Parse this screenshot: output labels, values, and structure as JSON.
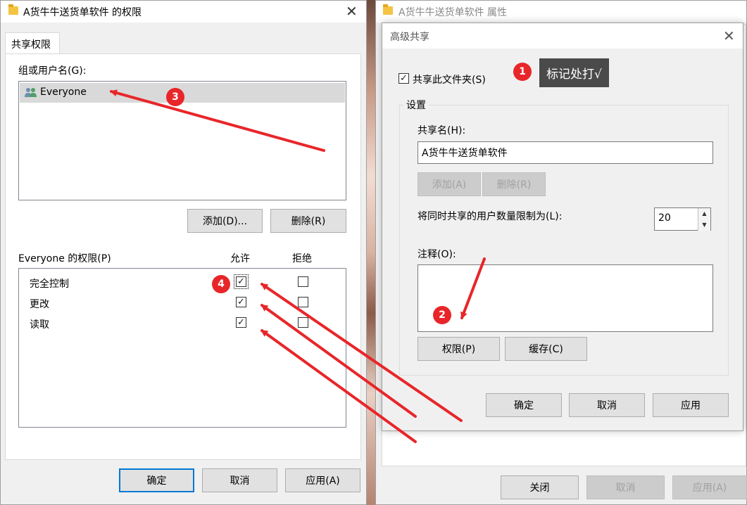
{
  "perm_dialog": {
    "title": "A货牛牛送货单软件 的权限",
    "tab": "共享权限",
    "group_label": "组或用户名(G):",
    "users": [
      {
        "name": "Everyone"
      }
    ],
    "add_button": "添加(D)...",
    "remove_button": "删除(R)",
    "perm_header": "Everyone 的权限(P)",
    "allow_header": "允许",
    "deny_header": "拒绝",
    "permissions": [
      {
        "name": "完全控制",
        "allow": true,
        "deny": false
      },
      {
        "name": "更改",
        "allow": true,
        "deny": false
      },
      {
        "name": "读取",
        "allow": true,
        "deny": false
      }
    ],
    "ok_button": "确定",
    "cancel_button": "取消",
    "apply_button": "应用(A)"
  },
  "props_dialog": {
    "title": "A货牛牛送货单软件 属性",
    "close_button": "关闭",
    "cancel_button": "取消",
    "apply_button": "应用(A)"
  },
  "adv_dialog": {
    "title": "高级共享",
    "share_checkbox_label": "共享此文件夹(S)",
    "share_checked": true,
    "settings_label": "设置",
    "share_name_label": "共享名(H):",
    "share_name_value": "A货牛牛送货单软件",
    "add_button": "添加(A)",
    "remove_button": "删除(R)",
    "limit_label": "将同时共享的用户数量限制为(L):",
    "limit_value": "20",
    "comment_label": "注释(O):",
    "permissions_button": "权限(P)",
    "caching_button": "缓存(C)",
    "ok_button": "确定",
    "cancel_button": "取消",
    "apply_button": "应用"
  },
  "annotations": {
    "tooltip": "标记处打√",
    "badges": [
      "1",
      "2",
      "3",
      "4"
    ],
    "arrow_color": "#e8262a"
  }
}
